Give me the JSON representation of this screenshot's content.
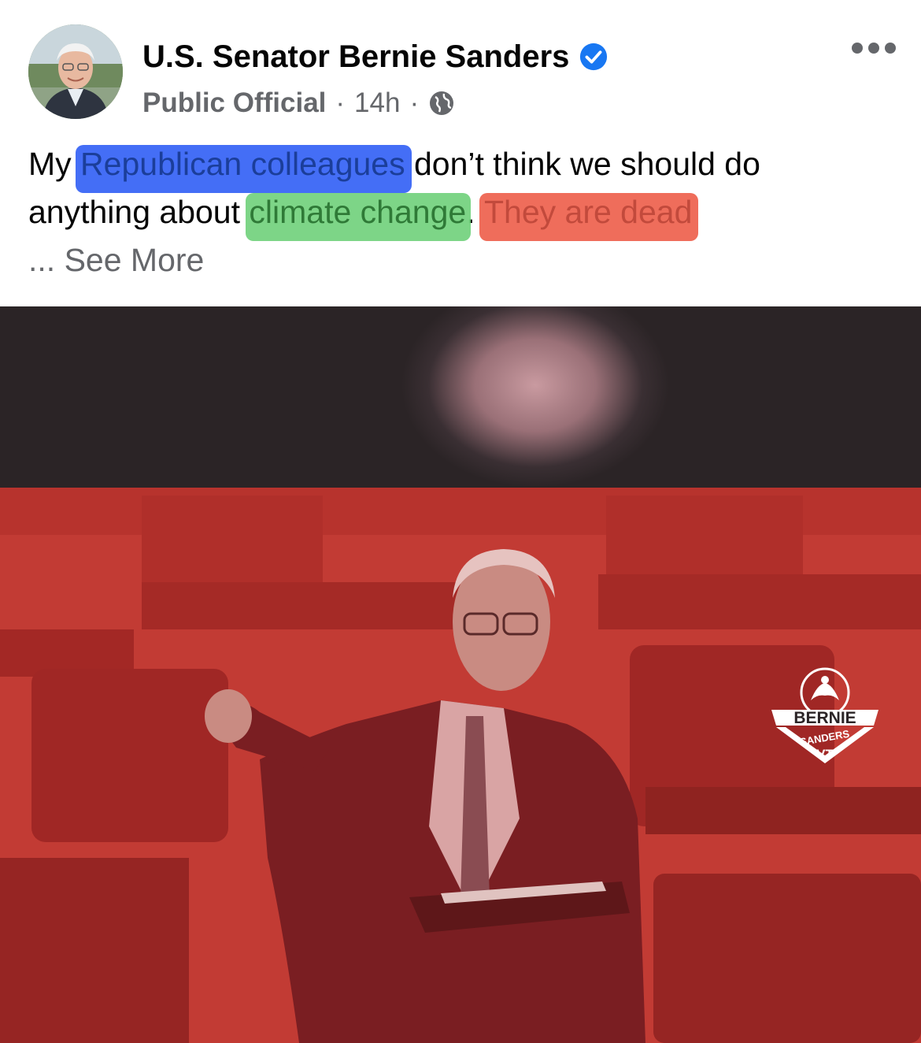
{
  "post": {
    "author": "U.S. Senator Bernie Sanders",
    "category": "Public Official",
    "separator": "·",
    "time": "14h",
    "text": {
      "line1_start": "My ",
      "highlight_blue": "Republican colleagues",
      "line1_end": " don’t think we should do",
      "line2_start": "anything about ",
      "highlight_green": "climate change",
      "line2_mid": ". ",
      "highlight_red": "They are dead",
      "ellipsis": "... ",
      "see_more": "See More"
    }
  },
  "video": {
    "logo_text": {
      "top": "BERNIE",
      "middle": "SANDERS",
      "bottom": "VT"
    }
  },
  "colors": {
    "highlight_blue": "#3a66f5",
    "highlight_green": "#6fd07a",
    "highlight_red": "#ee6552",
    "verified": "#1877f2",
    "video_tint": "#c23b34"
  },
  "icons": {
    "verified": "verified-badge-icon",
    "globe": "globe-icon",
    "more": "more-options-icon"
  }
}
